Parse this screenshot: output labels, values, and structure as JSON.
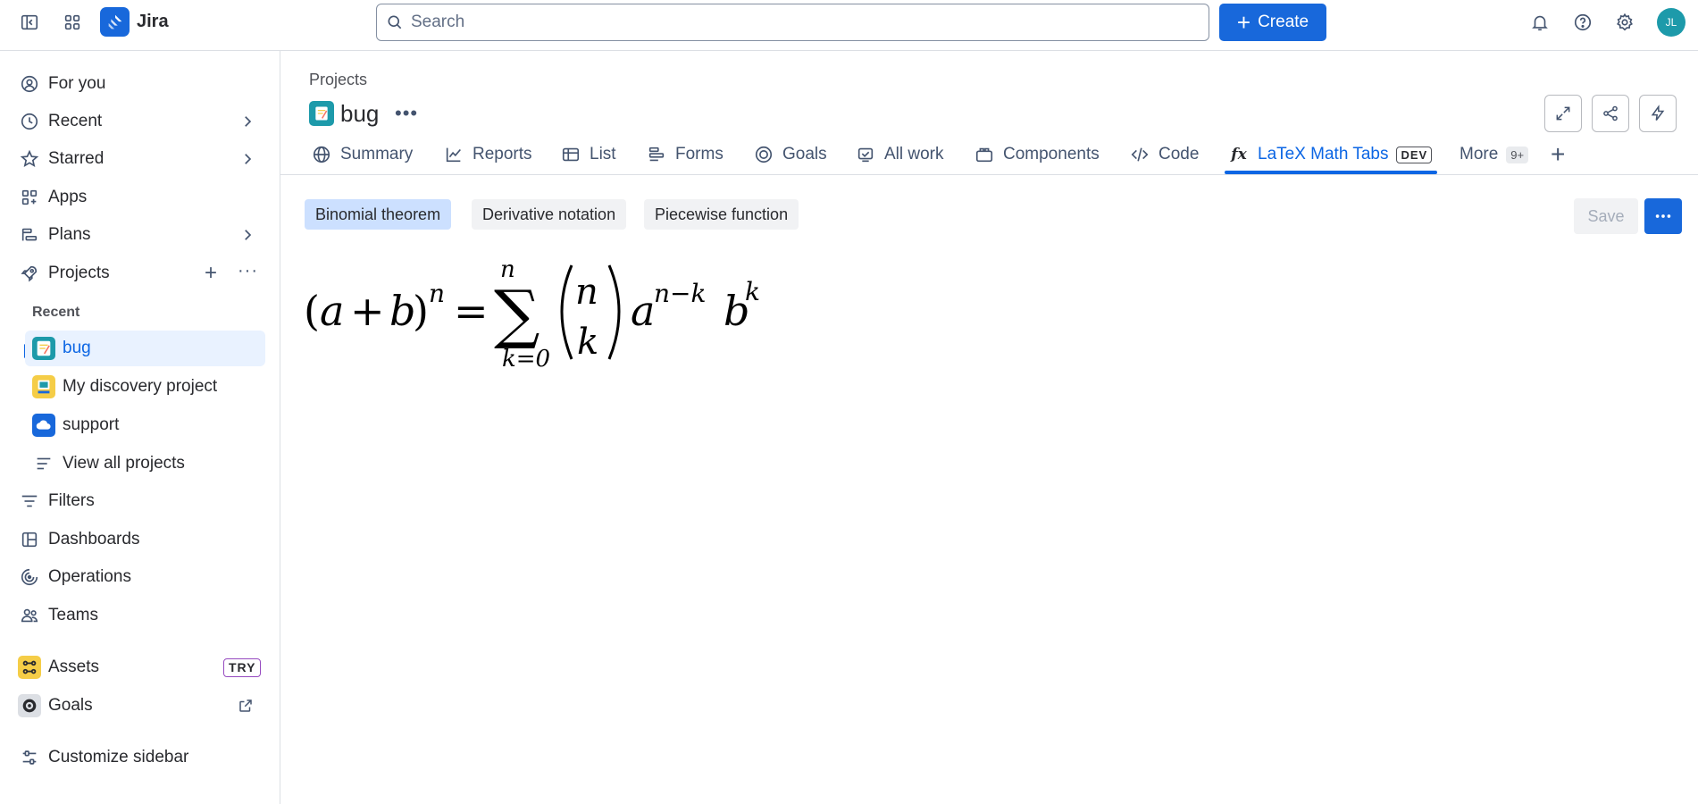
{
  "topbar": {
    "app_name": "Jira",
    "search_placeholder": "Search",
    "create_label": "Create",
    "avatar_initials": "JL",
    "brand_color": "#1868db"
  },
  "sidebar": {
    "for_you": "For you",
    "recent": "Recent",
    "starred": "Starred",
    "apps": "Apps",
    "plans": "Plans",
    "projects": "Projects",
    "recent_section": "Recent",
    "recent_projects": [
      {
        "name": "bug",
        "icon": "notepad-icon"
      },
      {
        "name": "My discovery project",
        "icon": "discovery-icon"
      },
      {
        "name": "support",
        "icon": "cloud-icon"
      }
    ],
    "view_all": "View all projects",
    "filters": "Filters",
    "dashboards": "Dashboards",
    "operations": "Operations",
    "teams": "Teams",
    "assets": "Assets",
    "assets_badge": "TRY",
    "goals": "Goals",
    "customize": "Customize sidebar"
  },
  "main": {
    "breadcrumb": "Projects",
    "project_title": "bug",
    "tabs": [
      {
        "label": "Summary",
        "icon": "globe-icon"
      },
      {
        "label": "Reports",
        "icon": "chart-line-icon"
      },
      {
        "label": "List",
        "icon": "table-icon"
      },
      {
        "label": "Forms",
        "icon": "form-icon"
      },
      {
        "label": "Goals",
        "icon": "target-icon"
      },
      {
        "label": "All work",
        "icon": "work-icon"
      },
      {
        "label": "Components",
        "icon": "component-icon"
      },
      {
        "label": "Code",
        "icon": "code-icon"
      },
      {
        "label": "LaTeX Math Tabs",
        "icon": "fx-icon"
      },
      {
        "label": "More",
        "icon": ""
      }
    ],
    "fx_glyph": "fx",
    "dev_badge": "DEV",
    "more_count": "9+",
    "formula_tabs": [
      "Binomial theorem",
      "Derivative notation",
      "Piecewise function"
    ],
    "save_label": "Save",
    "formula": {
      "lhs_open": "(",
      "a": "a",
      "plus": "+",
      "b": "b",
      "lhs_close": ")",
      "lhs_exp": "n",
      "equals": "=",
      "sigma": "∑",
      "sum_upper": "n",
      "sum_lower": "k=0",
      "binom_top": "n",
      "binom_bottom": "k",
      "term_a": "a",
      "term_a_exp": "n−k",
      "term_b": "b",
      "term_b_exp": "k"
    }
  }
}
